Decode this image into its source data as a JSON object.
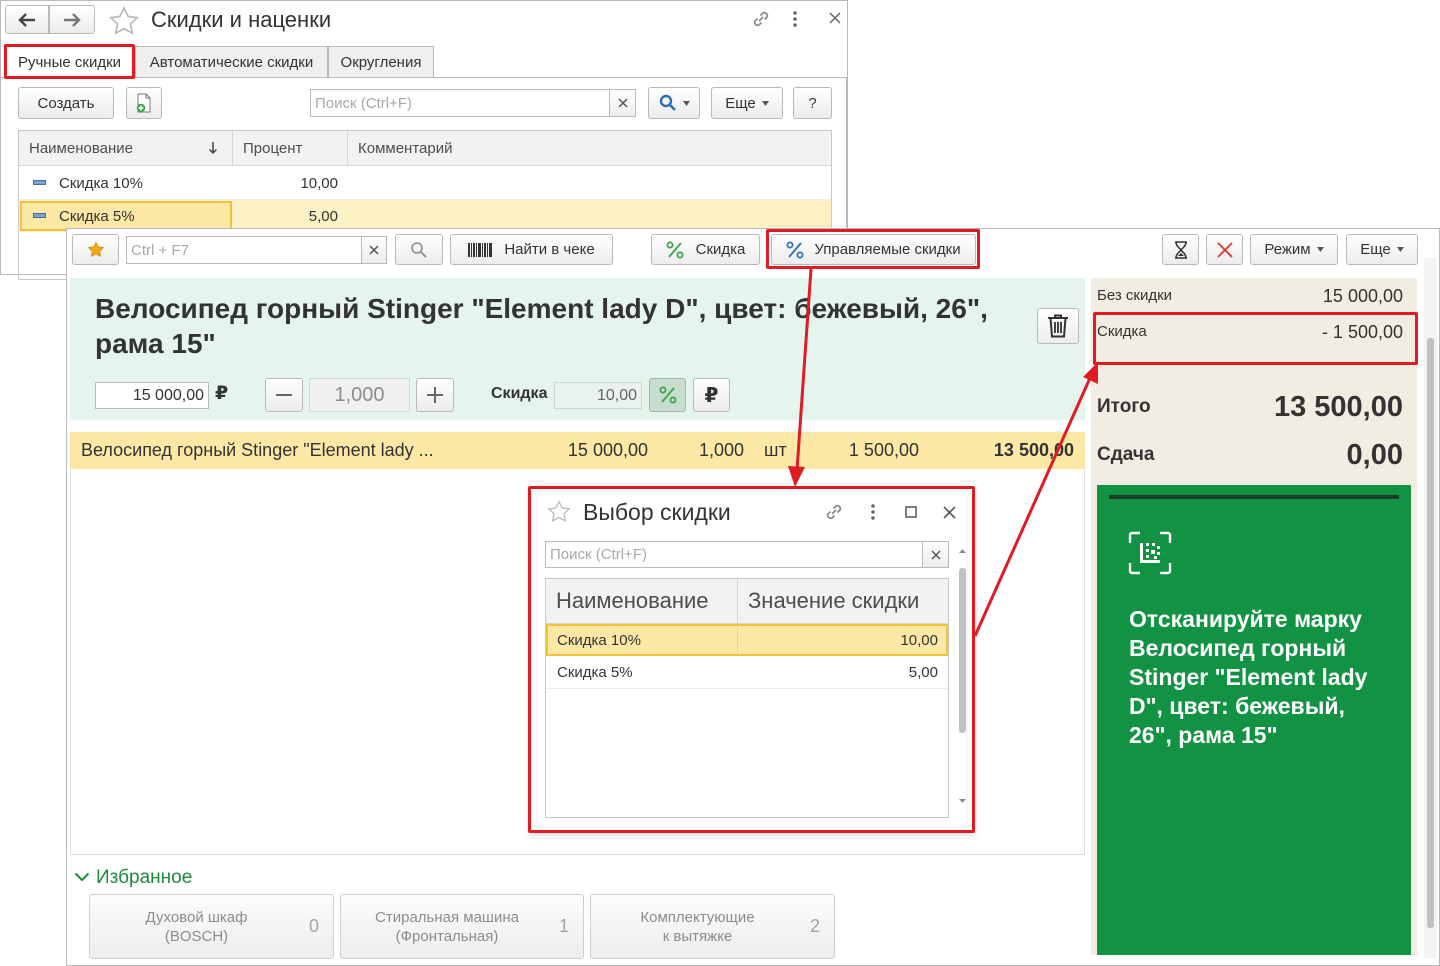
{
  "discounts_window": {
    "title": "Скидки и наценки",
    "tabs": [
      {
        "label": "Ручные скидки"
      },
      {
        "label": "Автоматические скидки"
      },
      {
        "label": "Округления"
      }
    ],
    "create_label": "Создать",
    "search_placeholder": "Поиск (Ctrl+F)",
    "more_label": "Еще",
    "help_label": "?",
    "columns": {
      "name": "Наименование",
      "percent": "Процент",
      "comment": "Комментарий"
    },
    "rows": [
      {
        "name": "Скидка 10%",
        "percent": "10,00",
        "comment": ""
      },
      {
        "name": "Скидка 5%",
        "percent": "5,00",
        "comment": ""
      }
    ]
  },
  "pos": {
    "toolbar": {
      "search_placeholder": "Ctrl + F7",
      "find_in_receipt_label": "Найти в чеке",
      "discount_label": "Скидка",
      "managed_discounts_label": "Управляемые скидки",
      "mode_label": "Режим",
      "more_label": "Еще"
    },
    "product": {
      "title": "Велосипед горный Stinger \"Element lady D\", цвет: бежевый, 26\", рама 15\"",
      "price": "15 000,00",
      "currency_symbol": "₽",
      "quantity": "1,000",
      "discount_label": "Скидка",
      "discount_value": "10,00"
    },
    "receipt_row": {
      "name": "Велосипед горный Stinger \"Element lady ...",
      "price": "15 000,00",
      "quantity": "1,000",
      "unit": "шт",
      "discount": "1 500,00",
      "total": "13 500,00"
    },
    "totals": {
      "without_discount_label": "Без скидки",
      "without_discount_value": "15 000,00",
      "discount_label": "Скидка",
      "discount_value": "- 1 500,00",
      "total_label": "Итого",
      "total_value": "13 500,00",
      "change_label": "Сдача",
      "change_value": "0,00"
    },
    "scan_message": "Отсканируйте марку Велосипед горный Stinger \"Element lady D\", цвет: бежевый, 26\", рама 15\"",
    "favorites": {
      "label": "Избранное",
      "items": [
        {
          "line1": "Духовой шкаф",
          "line2": "(BOSCH)",
          "count": "0"
        },
        {
          "line1": "Стиральная машина",
          "line2": "(Фронтальная)",
          "count": "1"
        },
        {
          "line1": "Комплектующие",
          "line2": "к вытяжке",
          "count": "2"
        }
      ]
    }
  },
  "dialog": {
    "title": "Выбор скидки",
    "search_placeholder": "Поиск (Ctrl+F)",
    "columns": {
      "name": "Наименование",
      "value": "Значение скидки"
    },
    "rows": [
      {
        "name": "Скидка 10%",
        "value": "10,00"
      },
      {
        "name": "Скидка 5%",
        "value": "5,00"
      }
    ]
  },
  "colors": {
    "highlight_red": "#e01b24",
    "selected_row": "#fde8a6",
    "product_panel": "#e6f4ee",
    "totals_panel": "#f1ede3",
    "scan_panel": "#119343",
    "favorites_green": "#1e8a3c"
  },
  "icons": [
    "back-arrow-icon",
    "forward-arrow-icon",
    "star-icon",
    "link-icon",
    "kebab-menu-icon",
    "close-icon",
    "copy-document-icon",
    "search-icon",
    "sort-arrow-down-icon",
    "barcode-icon",
    "percent-icon",
    "hourglass-icon",
    "trash-icon",
    "ruble-icon",
    "minus-icon",
    "plus-icon",
    "datamatrix-scan-icon",
    "chevron-down-icon",
    "maximize-icon"
  ]
}
